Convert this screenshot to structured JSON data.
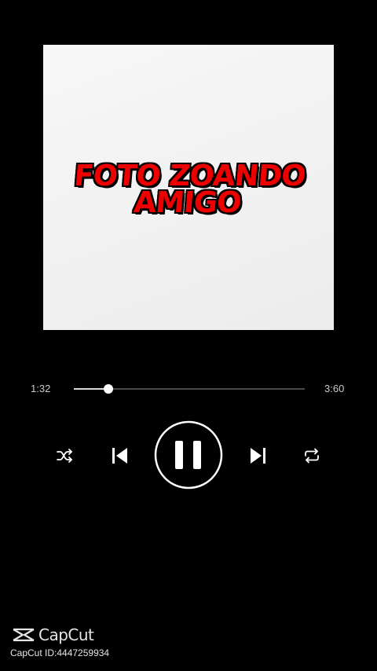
{
  "cover": {
    "title_line1": "FOTO ZOANDO",
    "title_line2": "AMIGO"
  },
  "player": {
    "current_time": "1:32",
    "total_time": "3:60",
    "progress_fraction": 0.15,
    "state": "playing",
    "controls": [
      "shuffle-icon",
      "previous-icon",
      "pause-icon",
      "next-icon",
      "repeat-icon"
    ]
  },
  "watermark": {
    "brand": "CapCut",
    "id_text": "CapCut ID:4447259934"
  },
  "colors": {
    "background": "#000000",
    "cover_title": "#ee0000",
    "accent": "#ffffff"
  }
}
